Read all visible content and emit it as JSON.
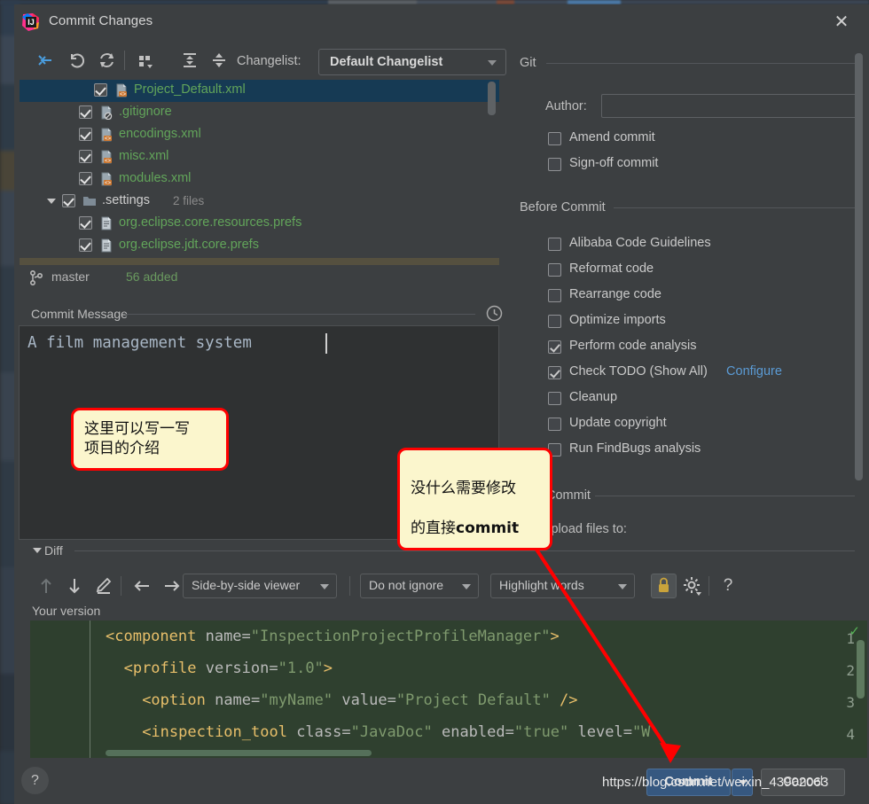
{
  "window": {
    "title": "Commit Changes",
    "app_icon": "intellij-idea-icon",
    "close_label": "✕"
  },
  "toolbar": {
    "icons": [
      {
        "name": "collapse-to-selection-icon",
        "glyph": "⬅"
      },
      {
        "name": "rollback-icon",
        "glyph": "↶"
      },
      {
        "name": "refresh-icon",
        "glyph": "⟳"
      },
      {
        "name": "group-by-icon",
        "glyph": "⁙"
      },
      {
        "name": "expand-all-icon",
        "glyph": "⬍"
      },
      {
        "name": "collapse-all-icon",
        "glyph": "⬍"
      }
    ],
    "changelist_label": "Changelist:",
    "changelist_value": "Default Changelist"
  },
  "file_tree": {
    "rows": [
      {
        "label": "Project_Default.xml",
        "checked": true,
        "selected": true,
        "indent": 84,
        "icon": "xml-file-icon",
        "color": "green",
        "folder": false,
        "expander": false,
        "count": ""
      },
      {
        "label": ".gitignore",
        "checked": true,
        "selected": false,
        "indent": 67,
        "icon": "gitignore-file-icon",
        "color": "green",
        "folder": false,
        "expander": false,
        "count": ""
      },
      {
        "label": "encodings.xml",
        "checked": true,
        "selected": false,
        "indent": 67,
        "icon": "xml-file-icon",
        "color": "green",
        "folder": false,
        "expander": false,
        "count": ""
      },
      {
        "label": "misc.xml",
        "checked": true,
        "selected": false,
        "indent": 67,
        "icon": "xml-file-icon",
        "color": "green",
        "folder": false,
        "expander": false,
        "count": ""
      },
      {
        "label": "modules.xml",
        "checked": true,
        "selected": false,
        "indent": 67,
        "icon": "xml-file-icon",
        "color": "green",
        "folder": false,
        "expander": false,
        "count": ""
      },
      {
        "label": ".settings",
        "checked": true,
        "selected": false,
        "indent": 48,
        "icon": "folder-icon",
        "color": "plain",
        "folder": true,
        "expander": true,
        "count": "2 files"
      },
      {
        "label": "org.eclipse.core.resources.prefs",
        "checked": true,
        "selected": false,
        "indent": 67,
        "icon": "prefs-file-icon",
        "color": "green",
        "folder": false,
        "expander": false,
        "count": ""
      },
      {
        "label": "org.eclipse.jdt.core.prefs",
        "checked": true,
        "selected": false,
        "indent": 67,
        "icon": "prefs-file-icon",
        "color": "green",
        "folder": false,
        "expander": false,
        "count": ""
      }
    ]
  },
  "branch_bar": {
    "icon": "git-branch-icon",
    "branch": "master",
    "status": "56 added"
  },
  "commit_message": {
    "section_title": "Commit Message",
    "history_icon": "history-clock-icon",
    "value": "A film management system"
  },
  "git_section": {
    "title": "Git",
    "author_label": "Author:",
    "author_value": "",
    "checkboxes": [
      {
        "label": "Amend commit",
        "checked": false
      },
      {
        "label": "Sign-off commit",
        "checked": false
      }
    ]
  },
  "before_commit_section": {
    "title": "Before Commit",
    "checkboxes": [
      {
        "label": "Alibaba Code Guidelines",
        "checked": false,
        "link": ""
      },
      {
        "label": "Reformat code",
        "checked": false,
        "link": ""
      },
      {
        "label": "Rearrange code",
        "checked": false,
        "link": ""
      },
      {
        "label": "Optimize imports",
        "checked": false,
        "link": ""
      },
      {
        "label": "Perform code analysis",
        "checked": true,
        "link": ""
      },
      {
        "label": "Check TODO (Show All)",
        "checked": true,
        "link": "Configure"
      },
      {
        "label": "Cleanup",
        "checked": false,
        "link": ""
      },
      {
        "label": "Update copyright",
        "checked": false,
        "link": ""
      },
      {
        "label": "Run FindBugs analysis",
        "checked": false,
        "link": ""
      }
    ]
  },
  "commit_section": {
    "title": "Commit",
    "upload_label": "Upload files to:"
  },
  "diff": {
    "section_title": "Diff",
    "toolbar_icons": [
      {
        "name": "previous-difference-icon",
        "glyph": "↑"
      },
      {
        "name": "next-difference-icon",
        "glyph": "↓"
      },
      {
        "name": "edit-source-icon",
        "glyph": "✎"
      },
      {
        "name": "accept-left-icon",
        "glyph": "←"
      },
      {
        "name": "accept-right-icon",
        "glyph": "→"
      }
    ],
    "viewer_mode": "Side-by-side viewer",
    "whitespace_mode": "Do not ignore",
    "highlight_mode": "Highlight words",
    "lock_icon": "lock-icon",
    "settings_icon": "gear-icon",
    "help_icon": "question-mark-icon",
    "your_version_label": "Your version",
    "code_lines": [
      {
        "num": "1",
        "indent": 0,
        "tokens": [
          {
            "t": "<component ",
            "c": "tag"
          },
          {
            "t": "name=",
            "c": "attr"
          },
          {
            "t": "\"InspectionProjectProfileManager\"",
            "c": "str"
          },
          {
            "t": ">",
            "c": "tag"
          }
        ]
      },
      {
        "num": "2",
        "indent": 2,
        "tokens": [
          {
            "t": "<profile ",
            "c": "tag"
          },
          {
            "t": "version=",
            "c": "attr"
          },
          {
            "t": "\"1.0\"",
            "c": "str"
          },
          {
            "t": ">",
            "c": "tag"
          }
        ]
      },
      {
        "num": "3",
        "indent": 4,
        "tokens": [
          {
            "t": "<option ",
            "c": "tag"
          },
          {
            "t": "name=",
            "c": "attr"
          },
          {
            "t": "\"myName\"",
            "c": "str"
          },
          {
            "t": " value=",
            "c": "attr"
          },
          {
            "t": "\"Project Default\"",
            "c": "str"
          },
          {
            "t": " />",
            "c": "tag"
          }
        ]
      },
      {
        "num": "4",
        "indent": 4,
        "tokens": [
          {
            "t": "<inspection_tool ",
            "c": "tag"
          },
          {
            "t": "class=",
            "c": "attr"
          },
          {
            "t": "\"JavaDoc\"",
            "c": "str"
          },
          {
            "t": " enabled=",
            "c": "attr"
          },
          {
            "t": "\"true\"",
            "c": "str"
          },
          {
            "t": " level=",
            "c": "attr"
          },
          {
            "t": "\"W",
            "c": "str"
          }
        ]
      }
    ]
  },
  "bottom_bar": {
    "help_label": "?",
    "commit_label": "Commit",
    "cancel_label": "Cancel",
    "watermark": "https://blog.csdn.net/weixin_43902063"
  },
  "annotations": [
    {
      "id": "callout-1",
      "text": "这里可以写一写\n项目的介绍"
    },
    {
      "id": "callout-2",
      "line1": "没什么需要修改",
      "line2_prefix": "的直接",
      "line2_bold": "commit"
    }
  ],
  "colors": {
    "dialog_bg": "#3c3f41",
    "selection": "#163a54",
    "file_green": "#62a55a",
    "link_blue": "#5b9bd5",
    "commit_button": "#365880",
    "annotation_fill": "#fbf6cd",
    "annotation_border": "#ff0000",
    "code_bg": "#2f402f"
  }
}
